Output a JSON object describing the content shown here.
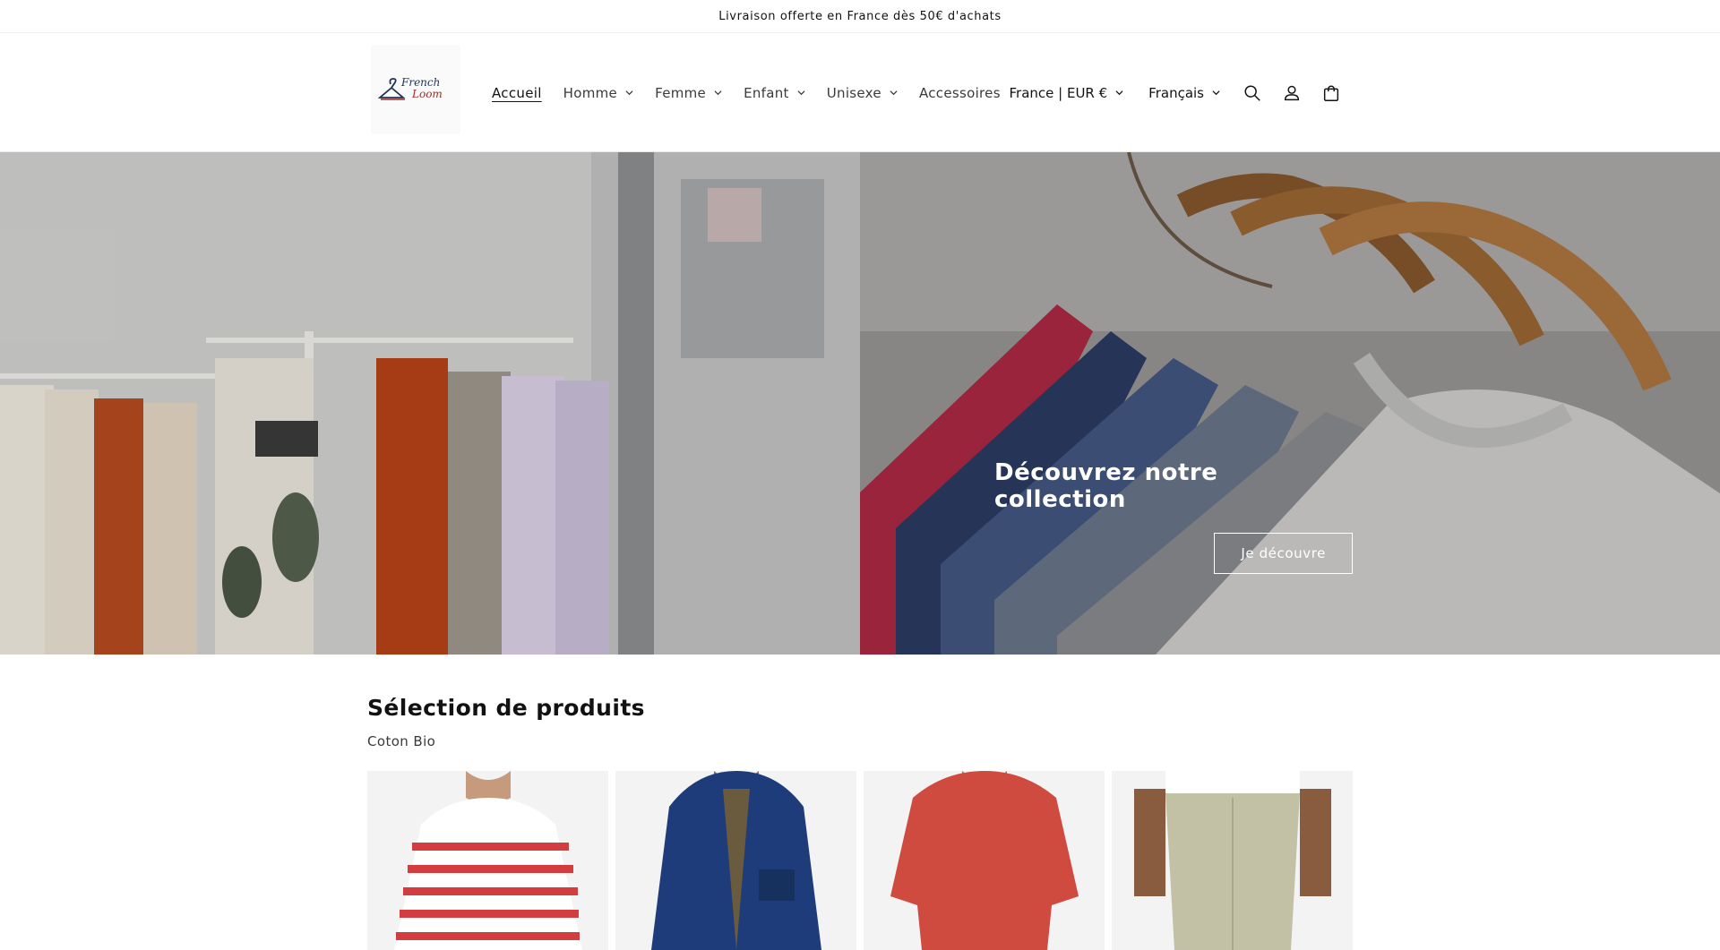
{
  "announcement": {
    "text": "Livraison offerte en France dès 50€ d'achats"
  },
  "brand": {
    "logo_line1": "French",
    "logo_line2": "Loom"
  },
  "nav": {
    "items": [
      {
        "label": "Accueil",
        "has_dropdown": false,
        "active": true
      },
      {
        "label": "Homme",
        "has_dropdown": true
      },
      {
        "label": "Femme",
        "has_dropdown": true
      },
      {
        "label": "Enfant",
        "has_dropdown": true
      },
      {
        "label": "Unisexe",
        "has_dropdown": true
      },
      {
        "label": "Accessoires",
        "has_dropdown": false
      }
    ]
  },
  "utility": {
    "country_currency": "France | EUR €",
    "language": "Français",
    "icons": [
      "search-icon",
      "account-icon",
      "cart-icon"
    ]
  },
  "hero": {
    "heading": "Découvrez notre collection",
    "button_label": "Je découvre"
  },
  "products_section": {
    "title": "Sélection de produits",
    "subtitle": "Coton Bio",
    "cards": [
      {
        "image": "striped-tshirt"
      },
      {
        "image": "navy-jacket"
      },
      {
        "image": "red-tshirt"
      },
      {
        "image": "beige-chino"
      }
    ]
  },
  "colors": {
    "text": "#121212",
    "muted": "#3a3a3a",
    "logo_navy": "#1f3354",
    "logo_red": "#9c2b2b"
  }
}
